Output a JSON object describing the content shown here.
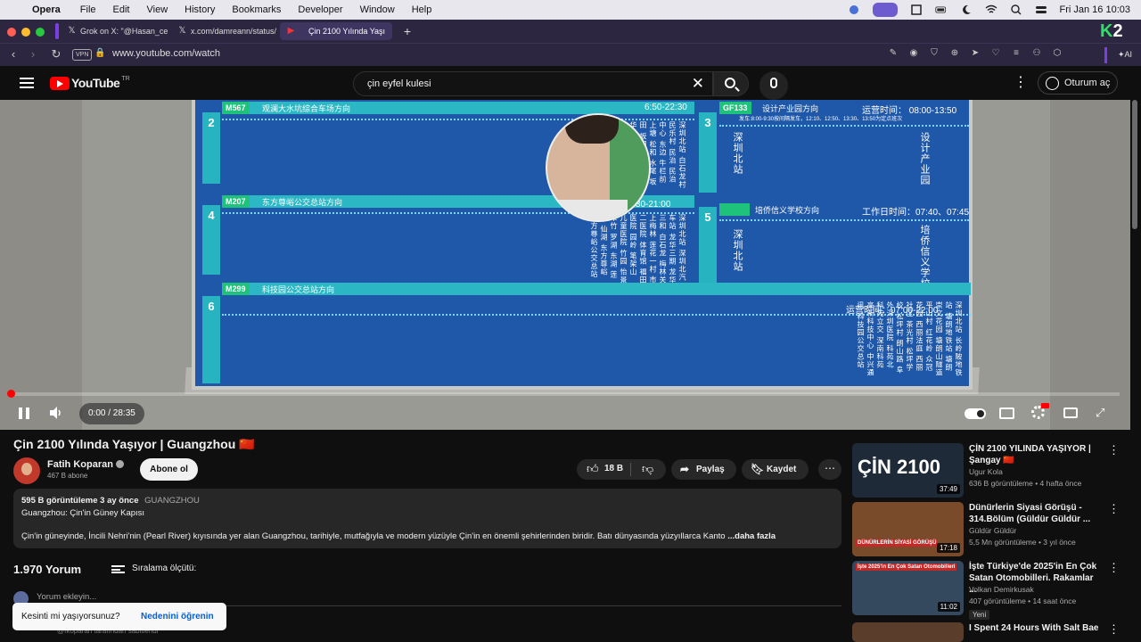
{
  "menubar": {
    "app": "Opera",
    "items": [
      "File",
      "Edit",
      "View",
      "History",
      "Bookmarks",
      "Developer",
      "Window",
      "Help"
    ],
    "clock": "Fri Jan 16  10:03"
  },
  "tabs": [
    {
      "label": "Grok on X: \"@Hasan_ce",
      "icon": "x-icon"
    },
    {
      "label": "x.com/damreann/status/",
      "icon": "x-icon"
    },
    {
      "label": "Çin 2100 Yılında Yaşı",
      "icon": "youtube-icon"
    }
  ],
  "browser": {
    "url": "www.youtube.com/watch",
    "vpn": "VPN",
    "ai": "AI",
    "k2": "2"
  },
  "yt": {
    "logo": "YouTube",
    "logo_sup": "TR",
    "search_value": "çin eyfel kulesi",
    "signin": "Oturum aç"
  },
  "player": {
    "time": "0:00 / 28:35",
    "progress_fraction": 0
  },
  "board": {
    "r2_tag": "M567",
    "r2_title": "观澜大水坑综合车场方向",
    "r2_hours": "6:50-22:30",
    "r3_tag": "GF133",
    "r3_title": "设计产业园方向",
    "r3_hours": "运营时间：  08:00-13:50",
    "r3_sub": "发车:8:00-9:30按间隔发车，12:10、12:50、13:30、13:50为定点班次",
    "r3_stop1": "深圳北站",
    "r3_stop2": "设计产业园",
    "r4_tag": "M207",
    "r4_title": "东方尊峪公交总站方向",
    "r4_hours": "运营时间：06:30-21:00",
    "r5_title": "培侨信义学校方向",
    "r5_hours": "工作日时间：07:40、07:45",
    "r5_stop1": "深圳北站",
    "r5_stop2": "培侨信义学校",
    "r6_tag": "M299",
    "r6_title": "科技园公交总站方向",
    "r6_hours": "运营时间：07:00-22:00",
    "numbers": [
      "2",
      "3",
      "4",
      "5",
      "6"
    ],
    "r2_stops": [
      "深圳北站",
      "白石龙村",
      "民乐村",
      "民治",
      "民治中心",
      "东边",
      "牛栏前",
      "上塘",
      "松和",
      "水尾",
      "坂田",
      "坂田北",
      "贝尔路",
      "华为基地",
      "岗头",
      "雪象",
      "马蹄山",
      "金坑",
      "新围",
      "平湖",
      "凤凰",
      "大水坑",
      "观澜",
      "观澜大水坑综合车场"
    ],
    "r4_stops": [
      "深圳北站",
      "深圳北汽车站",
      "龙华三期",
      "龙华三和",
      "白石龙",
      "梅林关",
      "上梅林",
      "莲花一村",
      "市二医院",
      "体育馆",
      "福田医院",
      "园岭",
      "笔架山",
      "儿童医院",
      "竹园",
      "怡景",
      "翠竹",
      "罗湖",
      "东湖",
      "莲塘",
      "仙湖",
      "东方尊峪",
      "东方尊峪公交总站"
    ],
    "r6_stops": [
      "深圳北站",
      "长岭陂地铁站",
      "塘朗地铁站",
      "塘朗",
      "崇文花园",
      "塘朗山隧道",
      "平山村",
      "红花岭",
      "众冠花园",
      "西丽法庭",
      "西丽社区",
      "茶光村",
      "松坪学校",
      "松坪村",
      "朗山路",
      "阜外深圳医院",
      "科苑北",
      "科苑立交",
      "深南科苑",
      "高新科技中心",
      "中兴通讯",
      "科技园公交总站"
    ]
  },
  "video": {
    "title": "Çin 2100 Yılında Yaşıyor | Guangzhou 🇨🇳",
    "channel": "Fatih Koparan",
    "subs": "467 B abone",
    "subscribe": "Abone ol",
    "likes": "18 B",
    "share": "Paylaş",
    "save": "Kaydet"
  },
  "description": {
    "views": "595 B görüntüleme",
    "ago": "3 ay önce",
    "tag": "GUANGZHOU",
    "subtitle": "Guangzhou: Çin'in Güney Kapısı",
    "body": "Çin'in güneyinde, İncili Nehri'nin (Pearl River) kıyısında yer alan Guangzhou, tarihiyle, mutfağıyla ve modern yüzüyle Çin'in en önemli şehirlerinden biridir. Batı dünyasında yüzyıllarca Kanto",
    "more": "...daha fazla"
  },
  "comments": {
    "count": "1.970 Yorum",
    "sort": "Sıralama ölçütü:",
    "placeholder": "Yorum ekleyin...",
    "ghost": "@fkoparan tarafından sabitlendi"
  },
  "toast": {
    "question": "Kesinti mi yaşıyorsunuz?",
    "link": "Nedenini öğrenin"
  },
  "sidebar": [
    {
      "title": "ÇİN 2100 YILINDA YAŞIYOR | Şangay 🇨🇳",
      "channel": "Ugur Kola",
      "meta": "636 B görüntüleme • 4 hafta önce",
      "duration": "37:49",
      "thumb_text": "ÇİN 2100",
      "badge": ""
    },
    {
      "title": "Dünürlerin Siyasi Görüşü - 314.Bölüm (Güldür Güldür ...",
      "channel": "Güldür Güldür",
      "meta": "5,5 Mn görüntüleme • 3 yıl önce",
      "duration": "17:18",
      "thumb_text": "DÜNÜRLERİN SİYASİ GÖRÜŞÜ",
      "badge": ""
    },
    {
      "title": "İşte Türkiye'de 2025'in En Çok Satan Otomobilleri. Rakamlar ...",
      "channel": "Volkan Demirkusak",
      "meta": "407 görüntüleme • 14 saat önce",
      "duration": "11:02",
      "thumb_text": "İşte 2025'in En Çok Satan Otomobilleri",
      "badge": "Yeni"
    },
    {
      "title": "I Spent 24 Hours With Salt Bae",
      "channel": "",
      "meta": "",
      "duration": "",
      "thumb_text": "",
      "badge": ""
    }
  ]
}
